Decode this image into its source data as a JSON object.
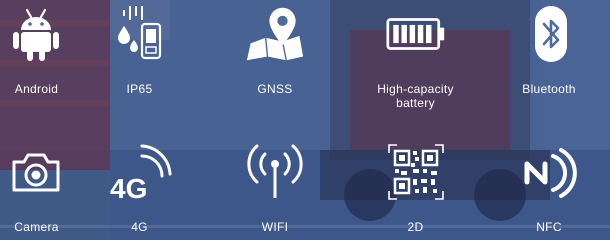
{
  "features": {
    "android": {
      "label": "Android",
      "icon": "android-icon"
    },
    "ip65": {
      "label": "IP65",
      "icon": "ip65-device-icon"
    },
    "gnss": {
      "label": "GNSS",
      "icon": "map-pin-icon"
    },
    "battery": {
      "label": "High-capacity\nbattery",
      "icon": "battery-icon"
    },
    "bluetooth": {
      "label": "Bluetooth",
      "icon": "bluetooth-icon"
    },
    "camera": {
      "label": "Camera",
      "icon": "camera-icon"
    },
    "four_g": {
      "label": "4G",
      "icon": "4g-signal-icon",
      "icon_text": "4G"
    },
    "wifi": {
      "label": "WIFI",
      "icon": "wifi-icon"
    },
    "two_d": {
      "label": "2D",
      "icon": "qr-code-icon"
    },
    "nfc": {
      "label": "NFC",
      "icon": "nfc-icon"
    }
  },
  "colors": {
    "overlay": "#3f5c8e",
    "icon": "#ffffff",
    "container_red": "#8a2a34",
    "forklift_red": "#b3323d"
  }
}
